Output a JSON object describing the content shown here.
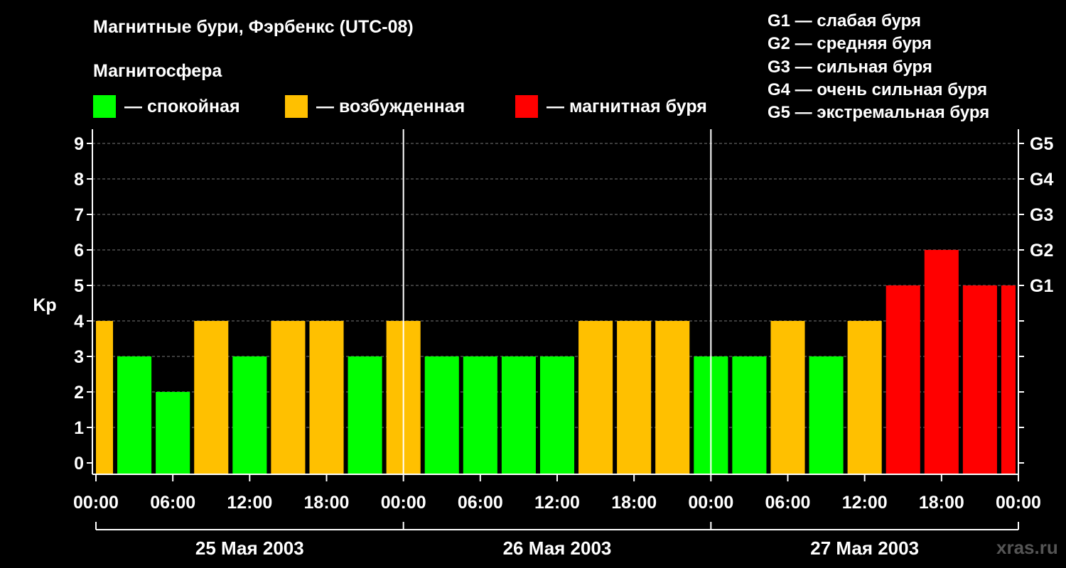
{
  "title": "Магнитные бури, Фэрбенкс (UTC-08)",
  "magnetosphere_label": "Магнитосфера",
  "legend": [
    {
      "label": "— спокойная",
      "color": "#00ff00"
    },
    {
      "label": "— возбужденная",
      "color": "#ffc000"
    },
    {
      "label": "— магнитная буря",
      "color": "#ff0000"
    }
  ],
  "g_legend": [
    "G1 — слабая буря",
    "G2 — средняя буря",
    "G3 — сильная буря",
    "G4 — очень сильная буря",
    "G5 — экстремальная буря"
  ],
  "watermark": "xras.ru",
  "chart_data": {
    "type": "bar",
    "ylabel": "Kp",
    "ylim": [
      0,
      9
    ],
    "yticks": [
      0,
      1,
      2,
      3,
      4,
      5,
      6,
      7,
      8,
      9
    ],
    "right_ticks": [
      {
        "value": 5,
        "label": "G1"
      },
      {
        "value": 6,
        "label": "G2"
      },
      {
        "value": 7,
        "label": "G3"
      },
      {
        "value": 8,
        "label": "G4"
      },
      {
        "value": 9,
        "label": "G5"
      }
    ],
    "x_tick_labels": [
      "00:00",
      "06:00",
      "12:00",
      "18:00",
      "00:00",
      "06:00",
      "12:00",
      "18:00",
      "00:00",
      "06:00",
      "12:00",
      "18:00",
      "00:00"
    ],
    "days": [
      "25 Мая 2003",
      "26 Мая 2003",
      "27 Мая 2003"
    ],
    "bar_interval_hours": 3,
    "start_hour": 0,
    "total_hours": 72,
    "values": [
      4,
      3,
      2,
      4,
      3,
      4,
      4,
      3,
      4,
      3,
      3,
      3,
      3,
      4,
      4,
      4,
      3,
      3,
      4,
      3,
      4,
      5,
      6,
      5,
      5
    ],
    "thresholds": {
      "quiet_max": 3,
      "active_max": 4
    },
    "grid": true
  }
}
